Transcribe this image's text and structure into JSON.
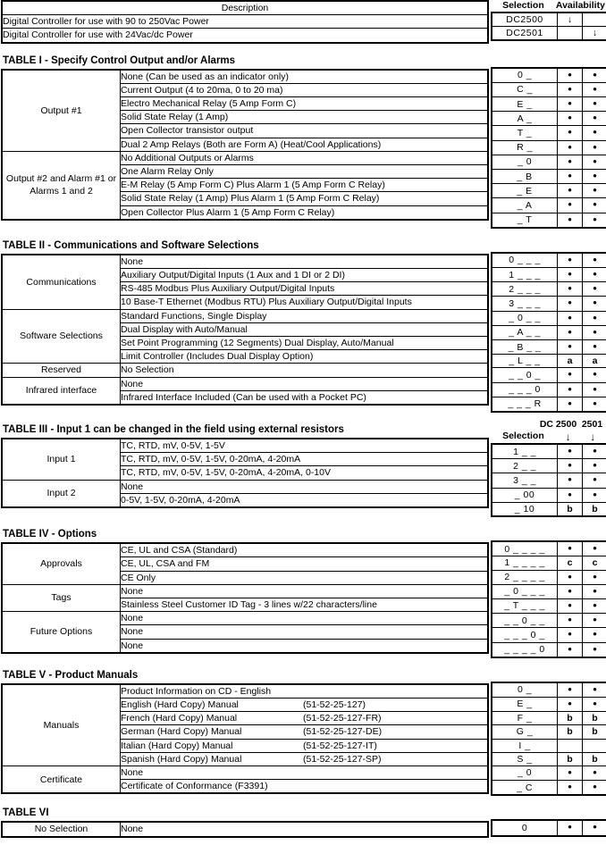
{
  "columns": {
    "description": "Description",
    "selection": "Selection",
    "availability": "Availability",
    "dc_label": "DC",
    "model_a": "2500",
    "model_b": "2501",
    "arrow": "↓"
  },
  "marks": {
    "dot": "•",
    "blank": ""
  },
  "header_table": {
    "rows": [
      {
        "desc": "Digital Controller for use with 90 to 250Vac Power",
        "sel": "DC2500",
        "a": "arrow",
        "b": ""
      },
      {
        "desc": "Digital Controller for use with 24Vac/dc Power",
        "sel": "DC2501",
        "a": "",
        "b": "arrow"
      }
    ]
  },
  "tables": [
    {
      "caption": "TABLE I - Specify Control Output and/or Alarms",
      "groups": [
        {
          "category": "Output #1",
          "rows": [
            {
              "desc": "None (Can be used as an indicator only)",
              "sel": "0 _",
              "a": "dot",
              "b": "dot"
            },
            {
              "desc": "Current Output  (4 to 20ma, 0 to 20 ma)",
              "sel": "C _",
              "a": "dot",
              "b": "dot"
            },
            {
              "desc": "Electro Mechanical Relay (5 Amp Form C)",
              "sel": "E _",
              "a": "dot",
              "b": "dot"
            },
            {
              "desc": "Solid State Relay (1 Amp)",
              "sel": "A _",
              "a": "dot",
              "b": "dot"
            },
            {
              "desc": "Open Collector transistor output",
              "sel": "T _",
              "a": "dot",
              "b": "dot"
            },
            {
              "desc": "Dual 2 Amp Relays (Both are Form A) (Heat/Cool Applications)",
              "sel": "R _",
              "a": "dot",
              "b": "dot"
            }
          ]
        },
        {
          "category": "Output #2 and Alarm #1 or Alarms 1 and 2",
          "rows": [
            {
              "desc": "No Additional Outputs or Alarms",
              "sel": "_ 0",
              "a": "dot",
              "b": "dot"
            },
            {
              "desc": "One Alarm Relay Only",
              "sel": "_ B",
              "a": "dot",
              "b": "dot"
            },
            {
              "desc": "E-M Relay (5 Amp Form C) Plus Alarm 1 (5 Amp Form C Relay)",
              "sel": "_ E",
              "a": "dot",
              "b": "dot"
            },
            {
              "desc": "Solid State Relay (1 Amp) Plus  Alarm 1 (5 Amp Form C Relay)",
              "sel": "_ A",
              "a": "dot",
              "b": "dot"
            },
            {
              "desc": "Open Collector Plus Alarm 1 (5 Amp Form C Relay)",
              "sel": "_ T",
              "a": "dot",
              "b": "dot"
            }
          ]
        }
      ]
    },
    {
      "caption": "TABLE II - Communications and Software Selections",
      "groups": [
        {
          "category": "Communications",
          "rows": [
            {
              "desc": "None",
              "sel": "0 _ _ _",
              "a": "dot",
              "b": "dot"
            },
            {
              "desc": "Auxiliary Output/Digital Inputs  (1 Aux and 1 DI or 2 DI)",
              "sel": "1 _ _ _",
              "a": "dot",
              "b": "dot"
            },
            {
              "desc": "RS-485 Modbus Plus Auxiliary Output/Digital Inputs",
              "sel": "2 _ _ _",
              "a": "dot",
              "b": "dot"
            },
            {
              "desc": "10 Base-T Ethernet (Modbus RTU) Plus Auxiliary Output/Digital Inputs",
              "sel": "3 _ _ _",
              "a": "dot",
              "b": "dot"
            }
          ]
        },
        {
          "category": "Software Selections",
          "rows": [
            {
              "desc": "Standard Functions, Single Display",
              "sel": "_ 0 _ _",
              "a": "dot",
              "b": "dot"
            },
            {
              "desc": "Dual Display with Auto/Manual",
              "sel": "_ A _ _",
              "a": "dot",
              "b": "dot"
            },
            {
              "desc": "Set Point Programming (12 Segments) Dual Display, Auto/Manual",
              "sel": "_ B _ _",
              "a": "dot",
              "b": "dot"
            },
            {
              "desc": "Limit Controller (Includes Dual Display Option)",
              "sel": "_ L _ _",
              "a": "a",
              "b": "a"
            }
          ]
        },
        {
          "category": "Reserved",
          "rows": [
            {
              "desc": "No Selection",
              "sel": "_ _ 0 _",
              "a": "dot",
              "b": "dot"
            }
          ]
        },
        {
          "category": "Infrared interface",
          "rows": [
            {
              "desc": "None",
              "sel": "_ _ _ 0",
              "a": "dot",
              "b": "dot"
            },
            {
              "desc": "Infrared Interface Included (Can be used with a Pocket PC)",
              "sel": "_ _ _ R",
              "a": "dot",
              "b": "dot"
            }
          ]
        }
      ]
    },
    {
      "caption": "TABLE III - Input 1 can be changed in the field using external resistors",
      "show_dc_header": true,
      "show_col_header": true,
      "groups": [
        {
          "category": "Input 1",
          "rows": [
            {
              "desc": "TC, RTD, mV, 0-5V, 1-5V",
              "sel": "1 _ _",
              "a": "dot",
              "b": "dot"
            },
            {
              "desc": "TC, RTD, mV, 0-5V, 1-5V, 0-20mA, 4-20mA",
              "sel": "2 _ _",
              "a": "dot",
              "b": "dot"
            },
            {
              "desc": "TC, RTD, mV, 0-5V, 1-5V, 0-20mA, 4-20mA, 0-10V",
              "sel": "3 _ _",
              "a": "dot",
              "b": "dot"
            }
          ]
        },
        {
          "category": "Input 2",
          "rows": [
            {
              "desc": "None",
              "sel": "_ 00",
              "a": "dot",
              "b": "dot"
            },
            {
              "desc": "0-5V, 1-5V, 0-20mA, 4-20mA",
              "sel": "_ 10",
              "a": "b",
              "b": "b"
            }
          ]
        }
      ]
    },
    {
      "caption": "TABLE IV - Options",
      "groups": [
        {
          "category": "Approvals",
          "rows": [
            {
              "desc": "CE, UL and CSA (Standard)",
              "sel": "0 _ _ _ _",
              "a": "dot",
              "b": "dot"
            },
            {
              "desc": "CE, UL, CSA and FM",
              "sel": "1 _ _ _ _",
              "a": "c",
              "b": "c"
            },
            {
              "desc": "CE Only",
              "sel": "2 _ _ _ _",
              "a": "dot",
              "b": "dot"
            }
          ]
        },
        {
          "category": "Tags",
          "rows": [
            {
              "desc": "None",
              "sel": "_ 0 _ _ _",
              "a": "dot",
              "b": "dot"
            },
            {
              "desc": "Stainless Steel Customer ID Tag - 3 lines w/22 characters/line",
              "sel": "_ T _ _ _",
              "a": "dot",
              "b": "dot"
            }
          ]
        },
        {
          "category": "Future Options",
          "divided": true,
          "rows": [
            {
              "desc": "None",
              "sel": "_ _ 0 _ _",
              "a": "dot",
              "b": "dot"
            },
            {
              "desc": "None",
              "sel": "_ _ _ 0 _",
              "a": "dot",
              "b": "dot"
            },
            {
              "desc": "None",
              "sel": "_ _ _ _ 0",
              "a": "dot",
              "b": "dot"
            }
          ]
        }
      ]
    },
    {
      "caption": "TABLE V - Product Manuals",
      "groups": [
        {
          "category": "Manuals",
          "rows": [
            {
              "desc": "Product Information on CD - English",
              "pn": "",
              "sel": "0 _",
              "a": "dot",
              "b": "dot"
            },
            {
              "desc": "English (Hard Copy) Manual",
              "pn": "(51-52-25-127)",
              "sel": "E _",
              "a": "dot",
              "b": "dot"
            },
            {
              "desc": "French (Hard Copy) Manual",
              "pn": "(51-52-25-127-FR)",
              "sel": "F _",
              "a": "b",
              "b": "b"
            },
            {
              "desc": "German (Hard Copy) Manual",
              "pn": "(51-52-25-127-DE)",
              "sel": "G _",
              "a": "b",
              "b": "b"
            },
            {
              "desc": "Italian (Hard Copy) Manual",
              "pn": "(51-52-25-127-IT)",
              "sel": "I _",
              "a": "",
              "b": ""
            },
            {
              "desc": "Spanish (Hard Copy) Manual",
              "pn": "(51-52-25-127-SP)",
              "sel": "S _",
              "a": "b",
              "b": "b"
            }
          ]
        },
        {
          "category": "Certificate",
          "rows": [
            {
              "desc": "None",
              "sel": "_ 0",
              "a": "dot",
              "b": "dot"
            },
            {
              "desc": "Certificate of Conformance (F3391)",
              "sel": "_ C",
              "a": "dot",
              "b": "dot"
            }
          ]
        }
      ]
    },
    {
      "caption": "TABLE VI",
      "groups": [
        {
          "category": "No Selection",
          "rows": [
            {
              "desc": "None",
              "sel": "0",
              "a": "dot",
              "b": "dot"
            }
          ]
        }
      ]
    }
  ]
}
